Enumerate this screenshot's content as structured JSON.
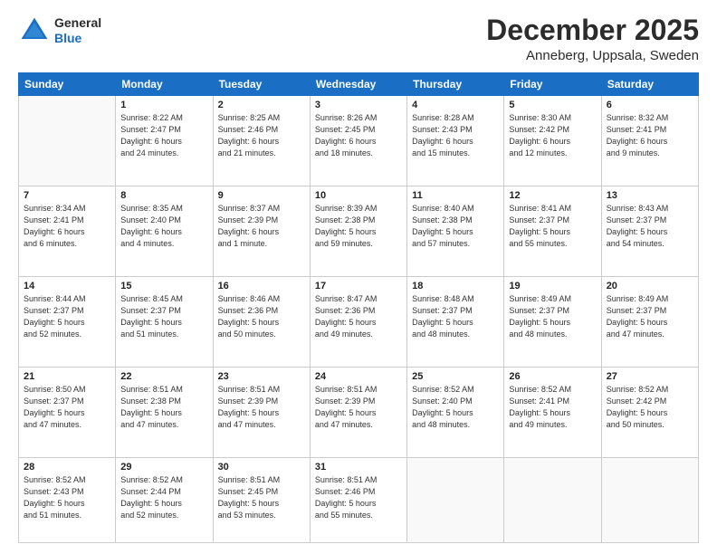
{
  "logo": {
    "line1": "General",
    "line2": "Blue"
  },
  "header": {
    "month": "December 2025",
    "location": "Anneberg, Uppsala, Sweden"
  },
  "weekdays": [
    "Sunday",
    "Monday",
    "Tuesday",
    "Wednesday",
    "Thursday",
    "Friday",
    "Saturday"
  ],
  "weeks": [
    [
      {
        "day": "",
        "info": ""
      },
      {
        "day": "1",
        "info": "Sunrise: 8:22 AM\nSunset: 2:47 PM\nDaylight: 6 hours\nand 24 minutes."
      },
      {
        "day": "2",
        "info": "Sunrise: 8:25 AM\nSunset: 2:46 PM\nDaylight: 6 hours\nand 21 minutes."
      },
      {
        "day": "3",
        "info": "Sunrise: 8:26 AM\nSunset: 2:45 PM\nDaylight: 6 hours\nand 18 minutes."
      },
      {
        "day": "4",
        "info": "Sunrise: 8:28 AM\nSunset: 2:43 PM\nDaylight: 6 hours\nand 15 minutes."
      },
      {
        "day": "5",
        "info": "Sunrise: 8:30 AM\nSunset: 2:42 PM\nDaylight: 6 hours\nand 12 minutes."
      },
      {
        "day": "6",
        "info": "Sunrise: 8:32 AM\nSunset: 2:41 PM\nDaylight: 6 hours\nand 9 minutes."
      }
    ],
    [
      {
        "day": "7",
        "info": "Sunrise: 8:34 AM\nSunset: 2:41 PM\nDaylight: 6 hours\nand 6 minutes."
      },
      {
        "day": "8",
        "info": "Sunrise: 8:35 AM\nSunset: 2:40 PM\nDaylight: 6 hours\nand 4 minutes."
      },
      {
        "day": "9",
        "info": "Sunrise: 8:37 AM\nSunset: 2:39 PM\nDaylight: 6 hours\nand 1 minute."
      },
      {
        "day": "10",
        "info": "Sunrise: 8:39 AM\nSunset: 2:38 PM\nDaylight: 5 hours\nand 59 minutes."
      },
      {
        "day": "11",
        "info": "Sunrise: 8:40 AM\nSunset: 2:38 PM\nDaylight: 5 hours\nand 57 minutes."
      },
      {
        "day": "12",
        "info": "Sunrise: 8:41 AM\nSunset: 2:37 PM\nDaylight: 5 hours\nand 55 minutes."
      },
      {
        "day": "13",
        "info": "Sunrise: 8:43 AM\nSunset: 2:37 PM\nDaylight: 5 hours\nand 54 minutes."
      }
    ],
    [
      {
        "day": "14",
        "info": "Sunrise: 8:44 AM\nSunset: 2:37 PM\nDaylight: 5 hours\nand 52 minutes."
      },
      {
        "day": "15",
        "info": "Sunrise: 8:45 AM\nSunset: 2:37 PM\nDaylight: 5 hours\nand 51 minutes."
      },
      {
        "day": "16",
        "info": "Sunrise: 8:46 AM\nSunset: 2:36 PM\nDaylight: 5 hours\nand 50 minutes."
      },
      {
        "day": "17",
        "info": "Sunrise: 8:47 AM\nSunset: 2:36 PM\nDaylight: 5 hours\nand 49 minutes."
      },
      {
        "day": "18",
        "info": "Sunrise: 8:48 AM\nSunset: 2:37 PM\nDaylight: 5 hours\nand 48 minutes."
      },
      {
        "day": "19",
        "info": "Sunrise: 8:49 AM\nSunset: 2:37 PM\nDaylight: 5 hours\nand 48 minutes."
      },
      {
        "day": "20",
        "info": "Sunrise: 8:49 AM\nSunset: 2:37 PM\nDaylight: 5 hours\nand 47 minutes."
      }
    ],
    [
      {
        "day": "21",
        "info": "Sunrise: 8:50 AM\nSunset: 2:37 PM\nDaylight: 5 hours\nand 47 minutes."
      },
      {
        "day": "22",
        "info": "Sunrise: 8:51 AM\nSunset: 2:38 PM\nDaylight: 5 hours\nand 47 minutes."
      },
      {
        "day": "23",
        "info": "Sunrise: 8:51 AM\nSunset: 2:39 PM\nDaylight: 5 hours\nand 47 minutes."
      },
      {
        "day": "24",
        "info": "Sunrise: 8:51 AM\nSunset: 2:39 PM\nDaylight: 5 hours\nand 47 minutes."
      },
      {
        "day": "25",
        "info": "Sunrise: 8:52 AM\nSunset: 2:40 PM\nDaylight: 5 hours\nand 48 minutes."
      },
      {
        "day": "26",
        "info": "Sunrise: 8:52 AM\nSunset: 2:41 PM\nDaylight: 5 hours\nand 49 minutes."
      },
      {
        "day": "27",
        "info": "Sunrise: 8:52 AM\nSunset: 2:42 PM\nDaylight: 5 hours\nand 50 minutes."
      }
    ],
    [
      {
        "day": "28",
        "info": "Sunrise: 8:52 AM\nSunset: 2:43 PM\nDaylight: 5 hours\nand 51 minutes."
      },
      {
        "day": "29",
        "info": "Sunrise: 8:52 AM\nSunset: 2:44 PM\nDaylight: 5 hours\nand 52 minutes."
      },
      {
        "day": "30",
        "info": "Sunrise: 8:51 AM\nSunset: 2:45 PM\nDaylight: 5 hours\nand 53 minutes."
      },
      {
        "day": "31",
        "info": "Sunrise: 8:51 AM\nSunset: 2:46 PM\nDaylight: 5 hours\nand 55 minutes."
      },
      {
        "day": "",
        "info": ""
      },
      {
        "day": "",
        "info": ""
      },
      {
        "day": "",
        "info": ""
      }
    ]
  ]
}
